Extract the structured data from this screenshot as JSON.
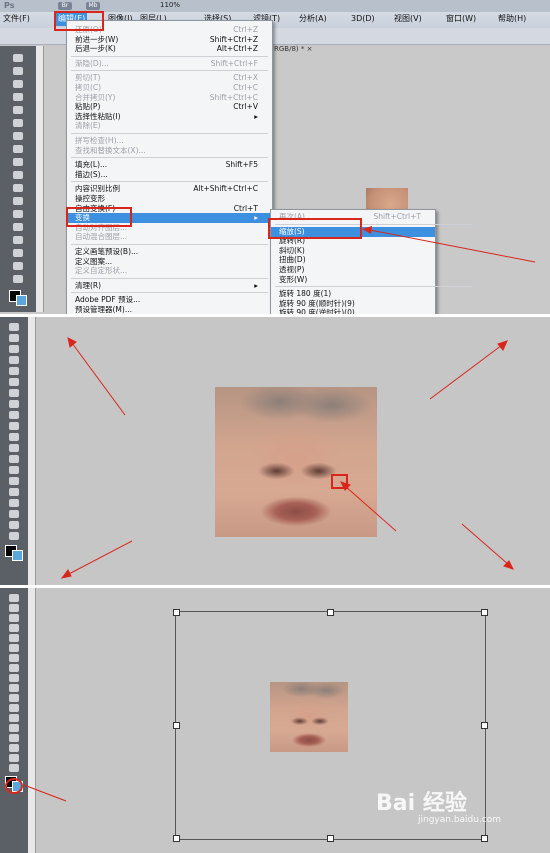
{
  "colors": {
    "menu_highlight": "#3d8fe0",
    "annotation_red": "#d9261c",
    "workspace_gray": "#c6c6c6",
    "toolbar_dark": "#5b6066"
  },
  "app": {
    "logo": "Ps",
    "zoom": "110%",
    "doc_tab": "1 @ 110% (图层 1, RGB/8) * ×"
  },
  "menubar": [
    "文件(F)",
    "编辑(E)",
    "图像(I)",
    "图层(L)",
    "选择(S)",
    "滤镜(T)",
    "分析(A)",
    "3D(D)",
    "视图(V)",
    "窗口(W)",
    "帮助(H)"
  ],
  "edit_menu": [
    {
      "label": "还原(O)",
      "shortcut": "Ctrl+Z",
      "disabled": true
    },
    {
      "label": "前进一步(W)",
      "shortcut": "Shift+Ctrl+Z",
      "disabled": false
    },
    {
      "label": "后退一步(K)",
      "shortcut": "Alt+Ctrl+Z",
      "disabled": false
    },
    {
      "sep": true
    },
    {
      "label": "渐隐(D)...",
      "shortcut": "Shift+Ctrl+F",
      "disabled": true
    },
    {
      "sep": true
    },
    {
      "label": "剪切(T)",
      "shortcut": "Ctrl+X",
      "disabled": true
    },
    {
      "label": "拷贝(C)",
      "shortcut": "Ctrl+C",
      "disabled": true
    },
    {
      "label": "合并拷贝(Y)",
      "shortcut": "Shift+Ctrl+C",
      "disabled": true
    },
    {
      "label": "粘贴(P)",
      "shortcut": "Ctrl+V",
      "disabled": false
    },
    {
      "label": "选择性粘贴(I)",
      "shortcut": "▸",
      "disabled": false
    },
    {
      "label": "清除(E)",
      "shortcut": "",
      "disabled": true
    },
    {
      "sep": true
    },
    {
      "label": "拼写检查(H)...",
      "shortcut": "",
      "disabled": true
    },
    {
      "label": "查找和替换文本(X)...",
      "shortcut": "",
      "disabled": true
    },
    {
      "sep": true
    },
    {
      "label": "填充(L)...",
      "shortcut": "Shift+F5",
      "disabled": false
    },
    {
      "label": "描边(S)...",
      "shortcut": "",
      "disabled": false
    },
    {
      "sep": true
    },
    {
      "label": "内容识别比例",
      "shortcut": "Alt+Shift+Ctrl+C",
      "disabled": false
    },
    {
      "label": "操控变形",
      "shortcut": "",
      "disabled": false
    },
    {
      "label": "自由变换(F)",
      "shortcut": "Ctrl+T",
      "disabled": false
    },
    {
      "label": "变换",
      "shortcut": "▸",
      "disabled": false,
      "highlight": true
    },
    {
      "label": "自动对齐图层...",
      "shortcut": "",
      "disabled": true
    },
    {
      "label": "自动混合图层...",
      "shortcut": "",
      "disabled": true
    },
    {
      "sep": true
    },
    {
      "label": "定义画笔预设(B)...",
      "shortcut": "",
      "disabled": false
    },
    {
      "label": "定义图案...",
      "shortcut": "",
      "disabled": false
    },
    {
      "label": "定义自定形状...",
      "shortcut": "",
      "disabled": true
    },
    {
      "sep": true
    },
    {
      "label": "清理(R)",
      "shortcut": "▸",
      "disabled": false
    },
    {
      "sep": true
    },
    {
      "label": "Adobe PDF 预设...",
      "shortcut": "",
      "disabled": false
    },
    {
      "label": "预设管理器(M)...",
      "shortcut": "",
      "disabled": false
    }
  ],
  "transform_submenu": [
    {
      "label": "再次(A)",
      "shortcut": "Shift+Ctrl+T",
      "disabled": true
    },
    {
      "sep": true
    },
    {
      "label": "缩放(S)",
      "shortcut": "",
      "disabled": false,
      "highlight": true
    },
    {
      "label": "旋转(R)",
      "shortcut": "",
      "disabled": false
    },
    {
      "label": "斜切(K)",
      "shortcut": "",
      "disabled": false
    },
    {
      "label": "扭曲(D)",
      "shortcut": "",
      "disabled": false
    },
    {
      "label": "透视(P)",
      "shortcut": "",
      "disabled": false
    },
    {
      "label": "变形(W)",
      "shortcut": "",
      "disabled": false
    },
    {
      "sep": true
    },
    {
      "label": "旋转 180 度(1)",
      "shortcut": "",
      "disabled": false
    },
    {
      "label": "旋转 90 度(顺时针)(9)",
      "shortcut": "",
      "disabled": false
    },
    {
      "label": "旋转 90 度(逆时针)(0)",
      "shortcut": "",
      "disabled": false
    }
  ],
  "watermark": {
    "logo": "Bai 经验",
    "url": "jingyan.baidu.com"
  }
}
